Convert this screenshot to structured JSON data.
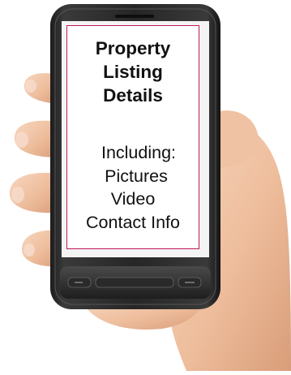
{
  "screen": {
    "title_lines": [
      "Property",
      "Listing",
      "Details"
    ],
    "body_lines": [
      "Including:",
      "Pictures",
      "Video",
      "Contact Info"
    ]
  },
  "colors": {
    "card_border": "#c2185b",
    "phone_body": "#2b2b2b",
    "skin": "#f2c7a8"
  },
  "icons": [
    "hand",
    "smartphone",
    "back-key-icon",
    "home-key-icon",
    "menu-key-icon"
  ]
}
